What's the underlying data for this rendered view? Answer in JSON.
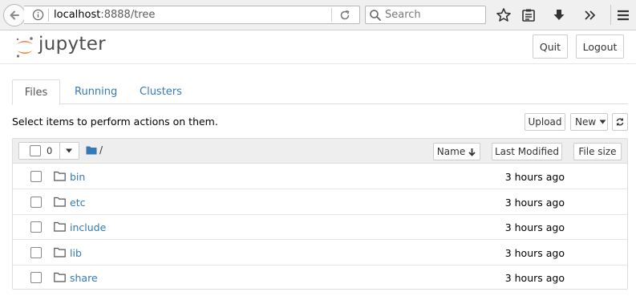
{
  "browser": {
    "url_host": "localhost",
    "url_rest": ":8888/tree",
    "search_placeholder": "Search"
  },
  "header": {
    "logo_text": "jupyter",
    "quit_label": "Quit",
    "logout_label": "Logout"
  },
  "tabs": [
    {
      "label": "Files",
      "active": true
    },
    {
      "label": "Running",
      "active": false
    },
    {
      "label": "Clusters",
      "active": false
    }
  ],
  "toolbar": {
    "hint": "Select items to perform actions on them.",
    "upload_label": "Upload",
    "new_label": "New"
  },
  "list_header": {
    "selected_count": "0",
    "breadcrumb": "/",
    "sort_name": "Name",
    "sort_modified": "Last Modified",
    "sort_size": "File size"
  },
  "files": [
    {
      "name": "bin",
      "modified": "3 hours ago"
    },
    {
      "name": "etc",
      "modified": "3 hours ago"
    },
    {
      "name": "include",
      "modified": "3 hours ago"
    },
    {
      "name": "lib",
      "modified": "3 hours ago"
    },
    {
      "name": "share",
      "modified": "3 hours ago"
    }
  ],
  "colors": {
    "link": "#337ab7",
    "logo_orange": "#f37726",
    "folder_blue": "#337ab7"
  }
}
